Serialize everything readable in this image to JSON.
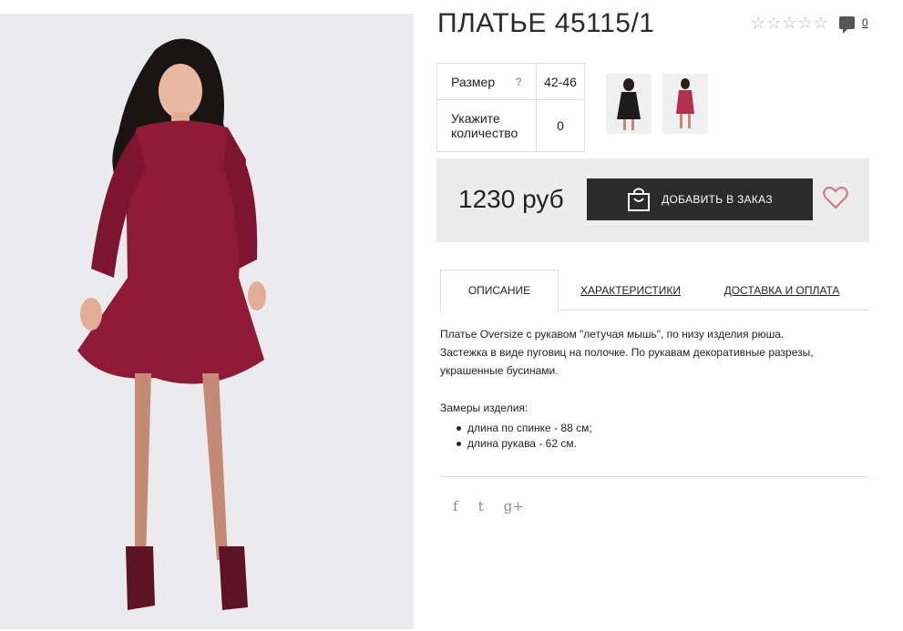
{
  "product": {
    "title": "ПЛАТЬЕ 45115/1",
    "rating_stars": 0,
    "rating_max": 5,
    "comments_count": "0"
  },
  "options": {
    "size_label": "Размер",
    "size_help": "?",
    "size_value": "42-46",
    "qty_label_line1": "Укажите",
    "qty_label_line2": "количество",
    "qty_value": "0"
  },
  "purchase": {
    "price": "1230 руб",
    "add_button_label": "ДОБАВИТЬ В ЗАКАЗ"
  },
  "tabs": {
    "description": "ОПИСАНИЕ",
    "characteristics": "ХАРАКТЕРИСТИКИ",
    "delivery": "ДОСТАВКА И ОПЛАТА"
  },
  "description": {
    "line1": "Платье Oversize с рукавом \"летучая мышь\", по низу изделия рюша.",
    "line2": "Застежка в виде пуговиц на полочке. По рукавам декоративные разрезы,",
    "line3": "украшенные бусинами.",
    "measures_title": "Замеры изделия:",
    "measures": [
      "длина по спинке - 88 см;",
      "длина рукава - 62 см."
    ]
  },
  "social": {
    "facebook": "f",
    "twitter": "t",
    "google": "g+"
  },
  "colors": {
    "dress": "#8e1a36",
    "button_bg": "#2b2b2b",
    "heart": "#d96b83",
    "panel_bg": "#ececec"
  },
  "icons": {
    "star": "star-outline-icon",
    "comments": "speech-bubble-icon",
    "bag": "shopping-bag-icon",
    "wishlist": "heart-icon"
  }
}
